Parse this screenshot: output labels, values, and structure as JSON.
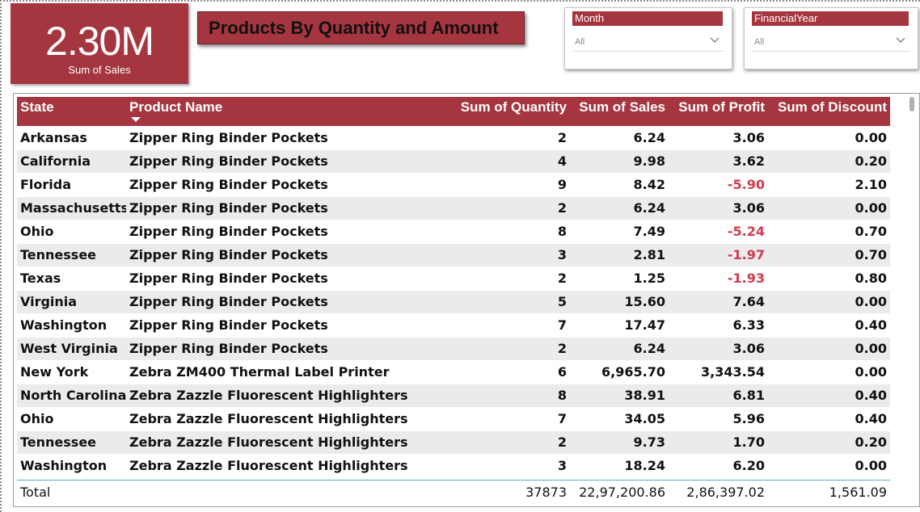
{
  "kpi": {
    "value": "2.30M",
    "label": "Sum of Sales"
  },
  "title": "Products By Quantity and Amount",
  "slicers": {
    "month": {
      "header": "Month",
      "value": "All"
    },
    "financial_year": {
      "header": "FinancialYear",
      "value": "All"
    }
  },
  "colors": {
    "accent": "#a5353f",
    "negative": "#d13b4d",
    "row_alt": "#ebebeb"
  },
  "table": {
    "columns": [
      "State",
      "Product Name",
      "Sum of Quantity",
      "Sum of Sales",
      "Sum of Profit",
      "Sum of Discount"
    ],
    "sorted_column": "Product Name",
    "rows": [
      {
        "state": "Arkansas",
        "product": "Zipper Ring Binder Pockets",
        "qty": "2",
        "sales": "6.24",
        "profit": "3.06",
        "discount": "0.00",
        "neg": false
      },
      {
        "state": "California",
        "product": "Zipper Ring Binder Pockets",
        "qty": "4",
        "sales": "9.98",
        "profit": "3.62",
        "discount": "0.20",
        "neg": false
      },
      {
        "state": "Florida",
        "product": "Zipper Ring Binder Pockets",
        "qty": "9",
        "sales": "8.42",
        "profit": "-5.90",
        "discount": "2.10",
        "neg": true
      },
      {
        "state": "Massachusetts",
        "product": "Zipper Ring Binder Pockets",
        "qty": "2",
        "sales": "6.24",
        "profit": "3.06",
        "discount": "0.00",
        "neg": false
      },
      {
        "state": "Ohio",
        "product": "Zipper Ring Binder Pockets",
        "qty": "8",
        "sales": "7.49",
        "profit": "-5.24",
        "discount": "0.70",
        "neg": true
      },
      {
        "state": "Tennessee",
        "product": "Zipper Ring Binder Pockets",
        "qty": "3",
        "sales": "2.81",
        "profit": "-1.97",
        "discount": "0.70",
        "neg": true
      },
      {
        "state": "Texas",
        "product": "Zipper Ring Binder Pockets",
        "qty": "2",
        "sales": "1.25",
        "profit": "-1.93",
        "discount": "0.80",
        "neg": true
      },
      {
        "state": "Virginia",
        "product": "Zipper Ring Binder Pockets",
        "qty": "5",
        "sales": "15.60",
        "profit": "7.64",
        "discount": "0.00",
        "neg": false
      },
      {
        "state": "Washington",
        "product": "Zipper Ring Binder Pockets",
        "qty": "7",
        "sales": "17.47",
        "profit": "6.33",
        "discount": "0.40",
        "neg": false
      },
      {
        "state": "West Virginia",
        "product": "Zipper Ring Binder Pockets",
        "qty": "2",
        "sales": "6.24",
        "profit": "3.06",
        "discount": "0.00",
        "neg": false
      },
      {
        "state": "New York",
        "product": "Zebra ZM400 Thermal Label Printer",
        "qty": "6",
        "sales": "6,965.70",
        "profit": "3,343.54",
        "discount": "0.00",
        "neg": false
      },
      {
        "state": "North Carolina",
        "product": "Zebra Zazzle Fluorescent Highlighters",
        "qty": "8",
        "sales": "38.91",
        "profit": "6.81",
        "discount": "0.40",
        "neg": false
      },
      {
        "state": "Ohio",
        "product": "Zebra Zazzle Fluorescent Highlighters",
        "qty": "7",
        "sales": "34.05",
        "profit": "5.96",
        "discount": "0.40",
        "neg": false
      },
      {
        "state": "Tennessee",
        "product": "Zebra Zazzle Fluorescent Highlighters",
        "qty": "2",
        "sales": "9.73",
        "profit": "1.70",
        "discount": "0.20",
        "neg": false
      },
      {
        "state": "Washington",
        "product": "Zebra Zazzle Fluorescent Highlighters",
        "qty": "3",
        "sales": "18.24",
        "profit": "6.20",
        "discount": "0.00",
        "neg": false
      }
    ],
    "total": {
      "label": "Total",
      "qty": "37873",
      "sales": "22,97,200.86",
      "profit": "2,86,397.02",
      "discount": "1,561.09"
    }
  }
}
